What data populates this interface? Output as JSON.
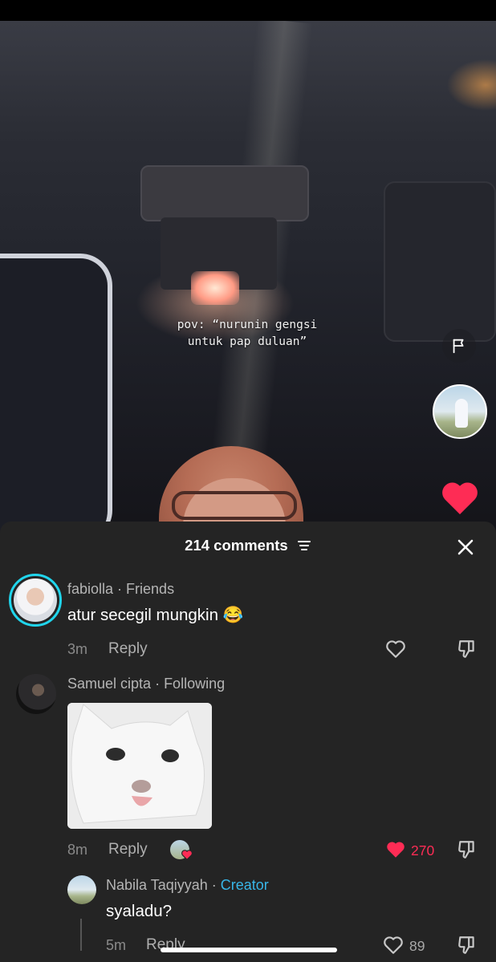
{
  "video": {
    "caption": "pov: “nurunin gengsi\nuntuk pap duluan”",
    "icons": [
      "flag-icon",
      "creator-avatar",
      "heart-icon"
    ],
    "liked": true
  },
  "comments_sheet": {
    "title": "214 comments",
    "sort_icon": "sort-icon",
    "close_icon": "close-icon",
    "comments": [
      {
        "username": "fabiolla",
        "relation": "Friends",
        "text": "atur secegil mungkin 😂",
        "time": "3m",
        "reply_label": "Reply",
        "like_count": "",
        "liked": false
      },
      {
        "username": "Samuel cipta",
        "relation": "Following",
        "text": "",
        "sticker": "cat-sticker",
        "time": "8m",
        "reply_label": "Reply",
        "like_count": "270",
        "liked": true,
        "liked_by_creator": true
      },
      {
        "username": "Nabila Taqiyyah",
        "relation": "Creator",
        "text": "syaladu?",
        "time": "5m",
        "reply_label": "Reply",
        "like_count": "89",
        "liked": false
      }
    ]
  },
  "colors": {
    "sheet_bg": "#242424",
    "like_red": "#fe2c55",
    "creator_blue": "#38b6e8",
    "story_ring": "#20d5ec"
  }
}
